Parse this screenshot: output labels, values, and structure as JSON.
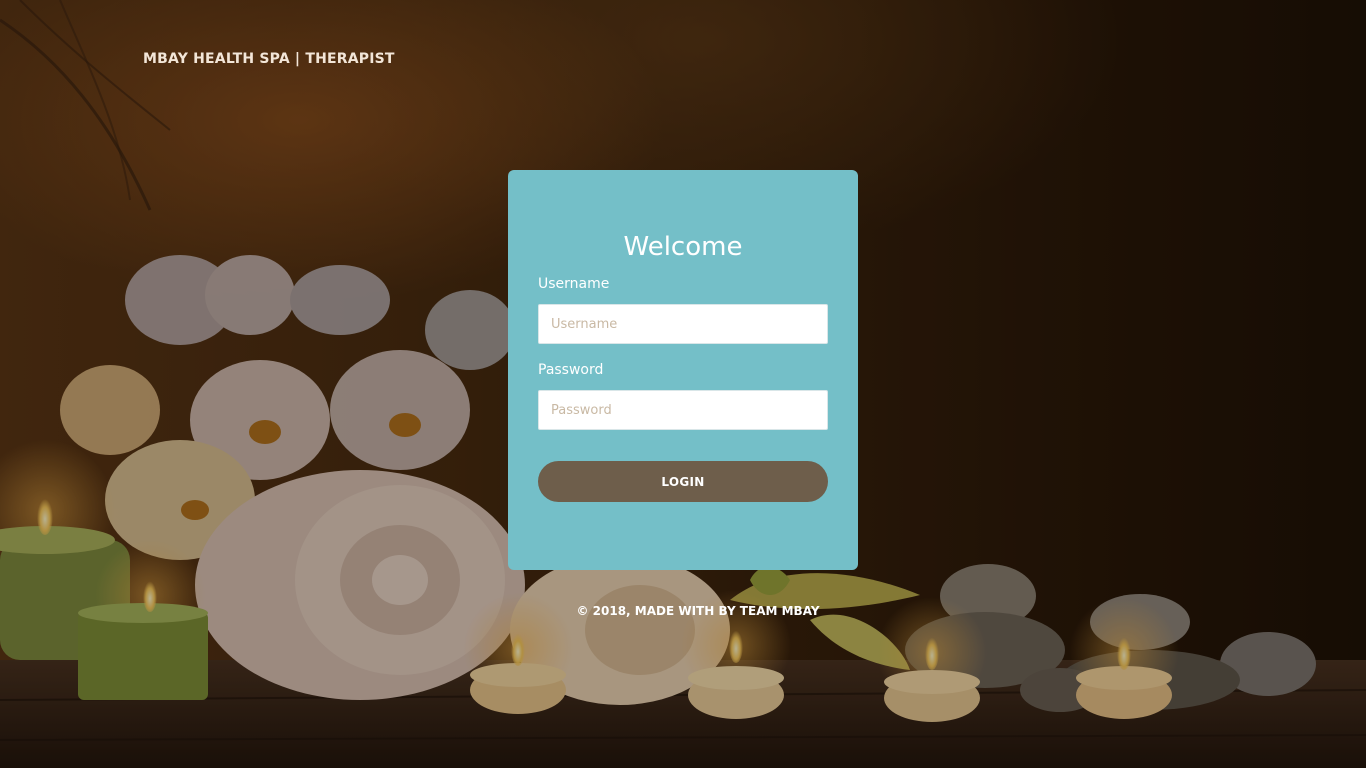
{
  "header": {
    "brand": "MBAY HEALTH SPA | THERAPIST"
  },
  "login_card": {
    "title": "Welcome",
    "username_label": "Username",
    "username_placeholder": "Username",
    "username_value": "",
    "password_label": "Password",
    "password_placeholder": "Password",
    "password_value": "",
    "login_label": "LOGIN"
  },
  "footer": {
    "text": "© 2018, MADE WITH BY TEAM MBAY"
  },
  "colors": {
    "card_background": "#74bfc8",
    "button_background": "#6e5e4b",
    "text_light": "#ffffff"
  }
}
